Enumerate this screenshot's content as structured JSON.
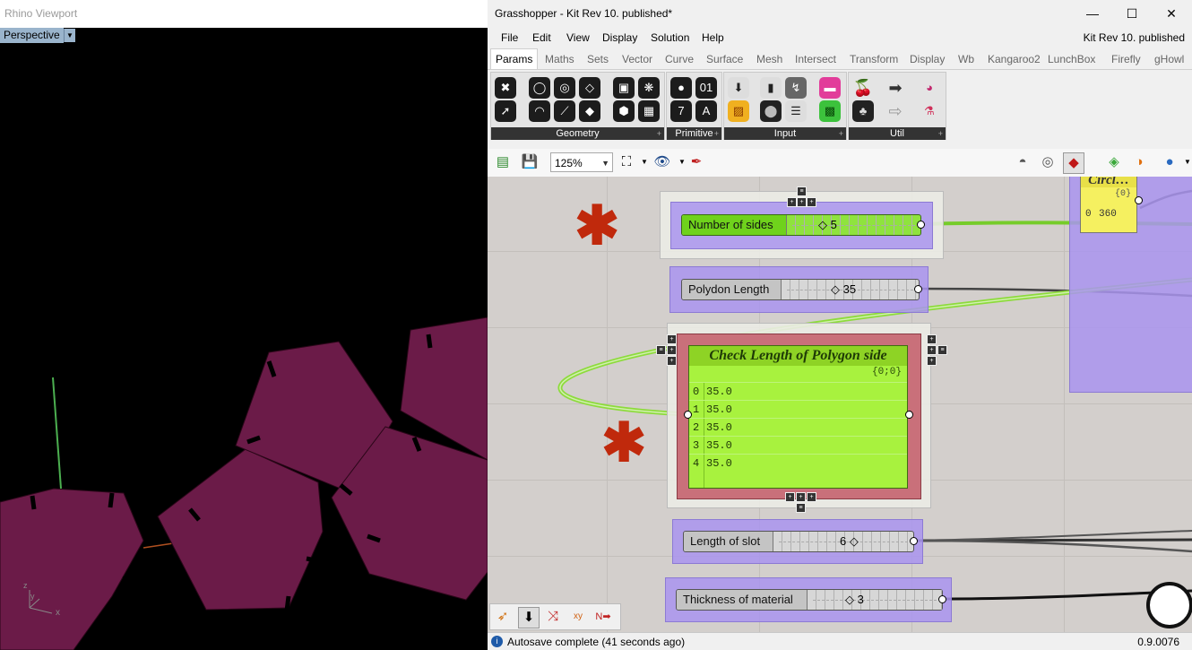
{
  "rhino": {
    "title": "Rhino Viewport",
    "viewport_label": "Perspective",
    "axis": {
      "y": "y",
      "z": "z",
      "x": "x"
    }
  },
  "gh": {
    "title": "Grasshopper - Kit Rev 10. published*",
    "doc_name": "Kit Rev 10. published",
    "window": {
      "minimize": "—",
      "maximize": "☐",
      "close": "✕"
    },
    "menu": [
      "File",
      "Edit",
      "View",
      "Display",
      "Solution",
      "Help"
    ],
    "tabs": [
      "Params",
      "Maths",
      "Sets",
      "Vector",
      "Curve",
      "Surface",
      "Mesh",
      "Intersect",
      "Transform",
      "Display",
      "Wb",
      "Kangaroo2",
      "LunchBox",
      "Firefly",
      "gHowl"
    ],
    "active_tab": "Params",
    "ribbon_groups": [
      "Geometry",
      "Primitive",
      "Input",
      "Util"
    ],
    "zoom": "125%",
    "status": "Autosave complete (41 seconds ago)",
    "version": "0.9.0076",
    "colors": {
      "group": "#a994ee",
      "panel": "#a8f23e",
      "wire_green": "#7fd12a",
      "component_red": "#c9707a"
    }
  },
  "components": {
    "number_of_sides": {
      "label": "Number of sides",
      "value": "5"
    },
    "polygon_length": {
      "label": "Polydon Length",
      "value": "35"
    },
    "length_of_slot": {
      "label": "Length of slot",
      "value": "6"
    },
    "thickness": {
      "label": "Thickness of material",
      "value": "3"
    },
    "circle_partial": {
      "title": "Circl…",
      "path": "{0}",
      "row_index": "0",
      "row_value": "360"
    },
    "panel": {
      "title": "Check Length of Polygon side",
      "path": "{0;0}",
      "rows": [
        {
          "index": "0",
          "value": "35.0"
        },
        {
          "index": "1",
          "value": "35.0"
        },
        {
          "index": "2",
          "value": "35.0"
        },
        {
          "index": "3",
          "value": "35.0"
        },
        {
          "index": "4",
          "value": "35.0"
        }
      ]
    }
  }
}
